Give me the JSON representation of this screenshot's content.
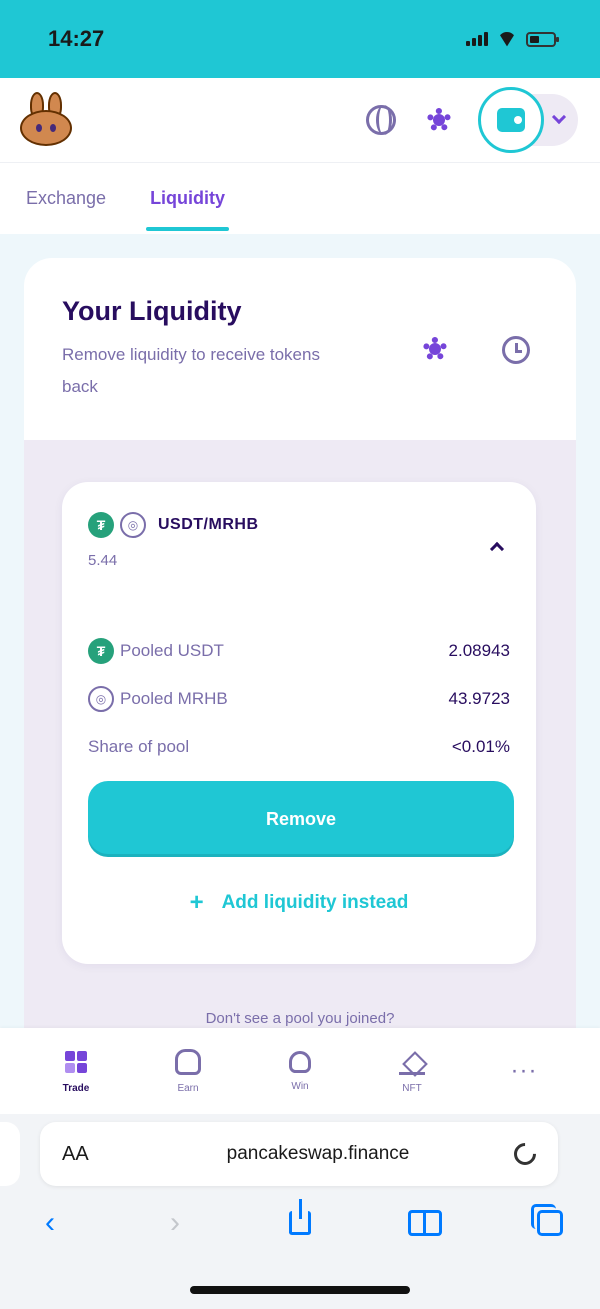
{
  "status_bar": {
    "time": "14:27"
  },
  "tabs": {
    "exchange": "Exchange",
    "liquidity": "Liquidity",
    "active": "Liquidity"
  },
  "liquidity": {
    "title": "Your Liquidity",
    "subtitle": "Remove liquidity to receive tokens back"
  },
  "position": {
    "pair": "USDT/MRHB",
    "amount": "5.44",
    "rows": [
      {
        "label": "Pooled USDT",
        "value": "2.08943"
      },
      {
        "label": "Pooled MRHB",
        "value": "43.9723"
      },
      {
        "label": "Share of pool",
        "value": "<0.01%"
      }
    ],
    "remove_label": "Remove",
    "add_label": "Add liquidity instead"
  },
  "footer_hint": "Don't see a pool you joined?",
  "bottom_nav": [
    {
      "label": "Trade",
      "icon": "trade-icon"
    },
    {
      "label": "Earn",
      "icon": "earn-icon"
    },
    {
      "label": "Win",
      "icon": "win-icon"
    },
    {
      "label": "NFT",
      "icon": "nft-icon"
    }
  ],
  "browser": {
    "aa": "AA",
    "url": "pancakeswap.finance"
  },
  "colors": {
    "primary": "#1fc7d4",
    "secondary": "#7645d9",
    "text": "#280d5f",
    "text_subtle": "#7a6eaa",
    "ios_blue": "#007aff"
  }
}
